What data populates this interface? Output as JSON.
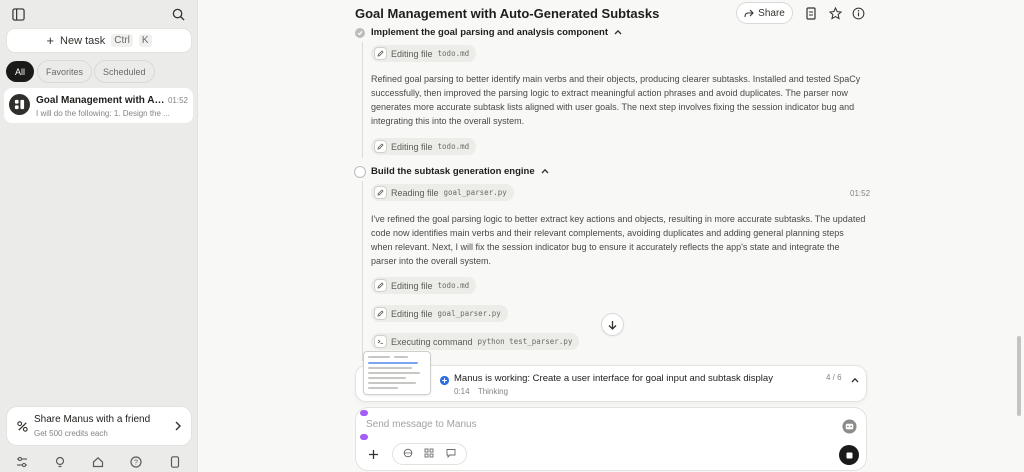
{
  "sidebar": {
    "new_task_label": "New task",
    "shortcut_ctrl": "Ctrl",
    "shortcut_key": "K",
    "filters": [
      {
        "label": "All",
        "active": true
      },
      {
        "label": "Favorites",
        "active": false
      },
      {
        "label": "Scheduled",
        "active": false
      }
    ],
    "task": {
      "title": "Goal Management with Auto-Generated Subtasks",
      "time": "01:52",
      "snippet": "I will do the following: 1. Design the ..."
    },
    "share": {
      "title": "Share Manus with a friend",
      "subtitle": "Get 500 credits each"
    },
    "bottom_icons": [
      "settings-sliders-icon",
      "lightbulb-icon",
      "home-icon",
      "help-icon",
      "mobile-icon"
    ]
  },
  "header": {
    "title": "Goal Management with Auto-Generated Subtasks",
    "share_label": "Share"
  },
  "steps": [
    {
      "title": "Implement the goal parsing and analysis component",
      "status": "done",
      "chips": [
        {
          "label": "Editing file",
          "file": "todo.md"
        },
        {
          "label": "Editing file",
          "file": "todo.md"
        }
      ],
      "paragraph": "Refined goal parsing to better identify main verbs and their objects, producing clearer subtasks. Installed and tested SpaCy successfully, then improved the parsing logic to extract meaningful action phrases and avoid duplicates. The parser now generates more accurate subtask lists aligned with user goals. The next step involves fixing the session indicator bug and integrating this into the overall system."
    },
    {
      "title": "Build the subtask generation engine",
      "status": "in-progress",
      "time": "01:52",
      "chips": [
        {
          "label": "Reading file",
          "file": "goal_parser.py"
        },
        {
          "label": "Editing file",
          "file": "todo.md"
        },
        {
          "label": "Editing file",
          "file": "goal_parser.py"
        },
        {
          "label": "Executing command",
          "file": "python test_parser.py"
        }
      ],
      "paragraph": "I've refined the goal parsing logic to better extract key actions and objects, resulting in more accurate subtasks. The updated code now identifies main verbs and their relevant complements, avoiding duplicates and adding general planning steps when relevant. Next, I will fix the session indicator bug to ensure it accurately reflects the app's state and integrate the parser into the overall system."
    }
  ],
  "status": {
    "text": "Manus is working: Create a user interface for goal input and subtask display",
    "elapsed": "0:14",
    "state": "Thinking",
    "progress": "4 / 6"
  },
  "input": {
    "placeholder": "Send message to Manus"
  },
  "colors": {
    "accent": "#1a1a19",
    "sidebar_bg": "#ebebea",
    "main_bg": "#f8f8f7",
    "working_blue": "#2f6fe4"
  }
}
